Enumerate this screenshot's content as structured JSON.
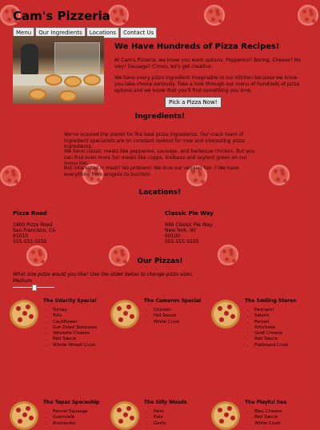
{
  "site": {
    "title": "Cam's Pizzeria"
  },
  "nav": {
    "tabs": [
      "Menu",
      "Our Ingredients",
      "Locations",
      "Contact Us"
    ]
  },
  "hero": {
    "heading": "We Have Hundreds of Pizza Recipes!",
    "para1": "At Cam's Pizzeria, we know you want options. Pepperoni? Boring. Cheese? No way! Sausage? C'mon, let's get creative.",
    "para2": "We have every pizza ingredient imaginable in our kitchen because we know you take choice seriously. Take a look through our menu of hundreds of pizza options and we know that you'll find something you love.",
    "button": "Pick a Pizza Now!"
  },
  "ingredients": {
    "heading": "Ingredients!",
    "p1": "We've scoured the planet for the best pizza ingredients. Our crack team of ingredient specialists are on constant lookout for new and interesting pizza ingredients.",
    "p2": "We have classic meats like pepperoni, sausage, and barbecue chicken. But you can find even more fun meats like coppa, kielbasa and soylent green on our menu too.",
    "p3": "Not interested in meat? No problem! We love our veggies too :) We have everything from arugula to zucchini."
  },
  "locations": {
    "heading": "Locations!",
    "items": [
      {
        "name": "Pizza Road",
        "line1": "1800 Pizza Road",
        "line2": "San Francisco, CA",
        "line3": "01010",
        "phone": "555-555-5555"
      },
      {
        "name": "Classic Pie Way",
        "line1": "999 Classic Pie Way",
        "line2": "New York, NY",
        "line3": "00100",
        "phone": "555-555-5555"
      }
    ]
  },
  "pizzas": {
    "heading": "Our Pizzas!",
    "slider_label": "What size pizza would you like? Use the slider below to change pizza sizes.",
    "size_value": "Medium",
    "slider_fraction": 0.5,
    "items": [
      {
        "name": "The Udacity Special",
        "toppings": [
          "Turkey",
          "Tofu",
          "Cauliflower",
          "Sun Dried Tomatoes",
          "Velveeta Cheese",
          "Red Sauce",
          "Whole Wheat Crust"
        ]
      },
      {
        "name": "The Cameron Special",
        "toppings": [
          "Chicken",
          "Hot Sauce",
          "White Crust"
        ]
      },
      {
        "name": "The Smiling Stereo",
        "toppings": [
          "Pastrami",
          "Salami",
          "Fennel",
          "Artichoke",
          "Goat Cheese",
          "Red Sauce",
          "Flatbread Crust"
        ]
      },
      {
        "name": "The Topaz Spaceship",
        "toppings": [
          "Fennel Sausage",
          "Guanciale",
          "Anchovies"
        ]
      },
      {
        "name": "The Silly Woods",
        "toppings": [
          "Ham",
          "Kale",
          "Garlic"
        ]
      },
      {
        "name": "The Playful Sea",
        "toppings": [
          "Bleu Cheese",
          "Red Sauce",
          "White Crust"
        ]
      }
    ]
  }
}
